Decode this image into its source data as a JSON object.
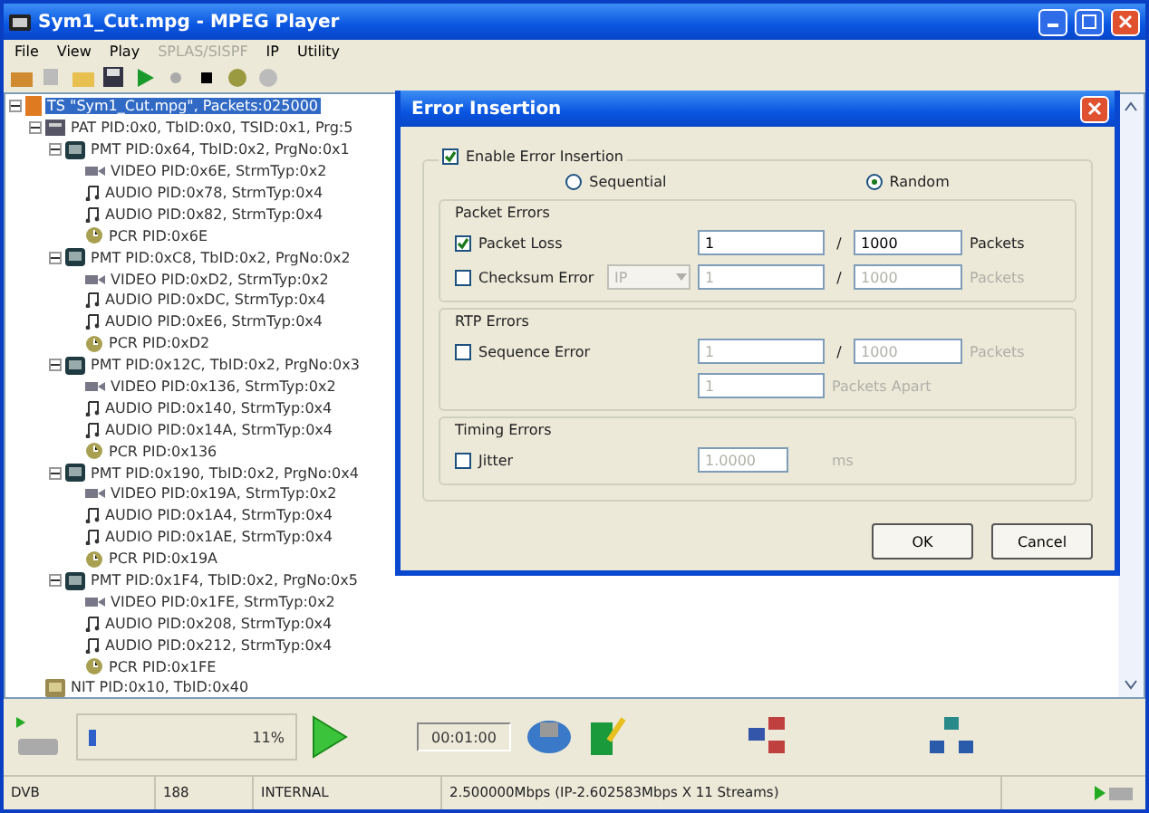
{
  "window": {
    "title": "Sym1_Cut.mpg - MPEG Player"
  },
  "menu": [
    {
      "label": "File",
      "disabled": false
    },
    {
      "label": "View",
      "disabled": false
    },
    {
      "label": "Play",
      "disabled": false
    },
    {
      "label": "SPLAS/SISPF",
      "disabled": true
    },
    {
      "label": "IP",
      "disabled": false
    },
    {
      "label": "Utility",
      "disabled": false
    }
  ],
  "tree": [
    {
      "kind": "ts",
      "label": "TS \"Sym1_Cut.mpg\", Packets:025000",
      "selected": true,
      "expanded": true,
      "children": [
        {
          "kind": "pat",
          "label": "PAT PID:0x0, TbID:0x0, TSID:0x1, Prg:5",
          "selected": false,
          "expanded": true,
          "children": [
            {
              "kind": "pmt",
              "label": "PMT PID:0x64, TbID:0x2, PrgNo:0x1",
              "selected": false,
              "expanded": true,
              "children": [
                {
                  "kind": "video",
                  "label": "VIDEO PID:0x6E, StrmTyp:0x2",
                  "selected": false
                },
                {
                  "kind": "audio",
                  "label": "AUDIO PID:0x78, StrmTyp:0x4",
                  "selected": false
                },
                {
                  "kind": "audio",
                  "label": "AUDIO PID:0x82, StrmTyp:0x4",
                  "selected": false
                },
                {
                  "kind": "pcr",
                  "label": "PCR PID:0x6E",
                  "selected": false
                }
              ]
            },
            {
              "kind": "pmt",
              "label": "PMT PID:0xC8, TbID:0x2, PrgNo:0x2",
              "selected": false,
              "expanded": true,
              "children": [
                {
                  "kind": "video",
                  "label": "VIDEO PID:0xD2, StrmTyp:0x2",
                  "selected": false
                },
                {
                  "kind": "audio",
                  "label": "AUDIO PID:0xDC, StrmTyp:0x4",
                  "selected": false
                },
                {
                  "kind": "audio",
                  "label": "AUDIO PID:0xE6, StrmTyp:0x4",
                  "selected": false
                },
                {
                  "kind": "pcr",
                  "label": "PCR PID:0xD2",
                  "selected": false
                }
              ]
            },
            {
              "kind": "pmt",
              "label": "PMT PID:0x12C, TbID:0x2, PrgNo:0x3",
              "selected": false,
              "expanded": true,
              "children": [
                {
                  "kind": "video",
                  "label": "VIDEO PID:0x136, StrmTyp:0x2",
                  "selected": false
                },
                {
                  "kind": "audio",
                  "label": "AUDIO PID:0x140, StrmTyp:0x4",
                  "selected": false
                },
                {
                  "kind": "audio",
                  "label": "AUDIO PID:0x14A, StrmTyp:0x4",
                  "selected": false
                },
                {
                  "kind": "pcr",
                  "label": "PCR PID:0x136",
                  "selected": false
                }
              ]
            },
            {
              "kind": "pmt",
              "label": "PMT PID:0x190, TbID:0x2, PrgNo:0x4",
              "selected": false,
              "expanded": true,
              "children": [
                {
                  "kind": "video",
                  "label": "VIDEO PID:0x19A, StrmTyp:0x2",
                  "selected": false
                },
                {
                  "kind": "audio",
                  "label": "AUDIO PID:0x1A4, StrmTyp:0x4",
                  "selected": false
                },
                {
                  "kind": "audio",
                  "label": "AUDIO PID:0x1AE, StrmTyp:0x4",
                  "selected": false
                },
                {
                  "kind": "pcr",
                  "label": "PCR PID:0x19A",
                  "selected": false
                }
              ]
            },
            {
              "kind": "pmt",
              "label": "PMT PID:0x1F4, TbID:0x2, PrgNo:0x5",
              "selected": false,
              "expanded": true,
              "children": [
                {
                  "kind": "video",
                  "label": "VIDEO PID:0x1FE, StrmTyp:0x2",
                  "selected": false
                },
                {
                  "kind": "audio",
                  "label": "AUDIO PID:0x208, StrmTyp:0x4",
                  "selected": false
                },
                {
                  "kind": "audio",
                  "label": "AUDIO PID:0x212, StrmTyp:0x4",
                  "selected": false
                },
                {
                  "kind": "pcr",
                  "label": "PCR PID:0x1FE",
                  "selected": false
                }
              ]
            }
          ]
        },
        {
          "kind": "nit",
          "label": "NIT PID:0x10, TbID:0x40",
          "selected": false
        }
      ]
    }
  ],
  "dialog": {
    "title": "Error Insertion",
    "enable": {
      "label": "Enable Error Insertion",
      "checked": true
    },
    "modes": [
      {
        "label": "Sequential",
        "selected": false
      },
      {
        "label": "Random",
        "selected": true
      }
    ],
    "groups": [
      {
        "title": "Packet Errors",
        "rows": [
          {
            "kind": "ratio",
            "label": "Packet Loss",
            "checked": true,
            "numerator": "1",
            "separator": "/",
            "denominator": "1000",
            "unit": "Packets"
          },
          {
            "kind": "ratio",
            "label": "Checksum Error",
            "checked": false,
            "select": "IP",
            "numerator": "1",
            "separator": "/",
            "denominator": "1000",
            "unit": "Packets"
          }
        ]
      },
      {
        "title": "RTP Errors",
        "rows": [
          {
            "kind": "ratio",
            "label": "Sequence Error",
            "checked": false,
            "numerator": "1",
            "separator": "/",
            "denominator": "1000",
            "unit": "Packets",
            "extra": {
              "value": "1",
              "unit": "Packets Apart"
            }
          }
        ]
      },
      {
        "title": "Timing Errors",
        "rows": [
          {
            "kind": "value",
            "label": "Jitter",
            "checked": false,
            "value": "1.0000",
            "unit": "ms"
          }
        ]
      }
    ],
    "buttons": [
      "OK",
      "Cancel"
    ]
  },
  "player": {
    "level": 0.05,
    "percent": "11%",
    "time": "00:01:00"
  },
  "status_bar": [
    "DVB",
    "188",
    "INTERNAL",
    "2.500000Mbps (IP-2.602583Mbps X 11 Streams)"
  ]
}
